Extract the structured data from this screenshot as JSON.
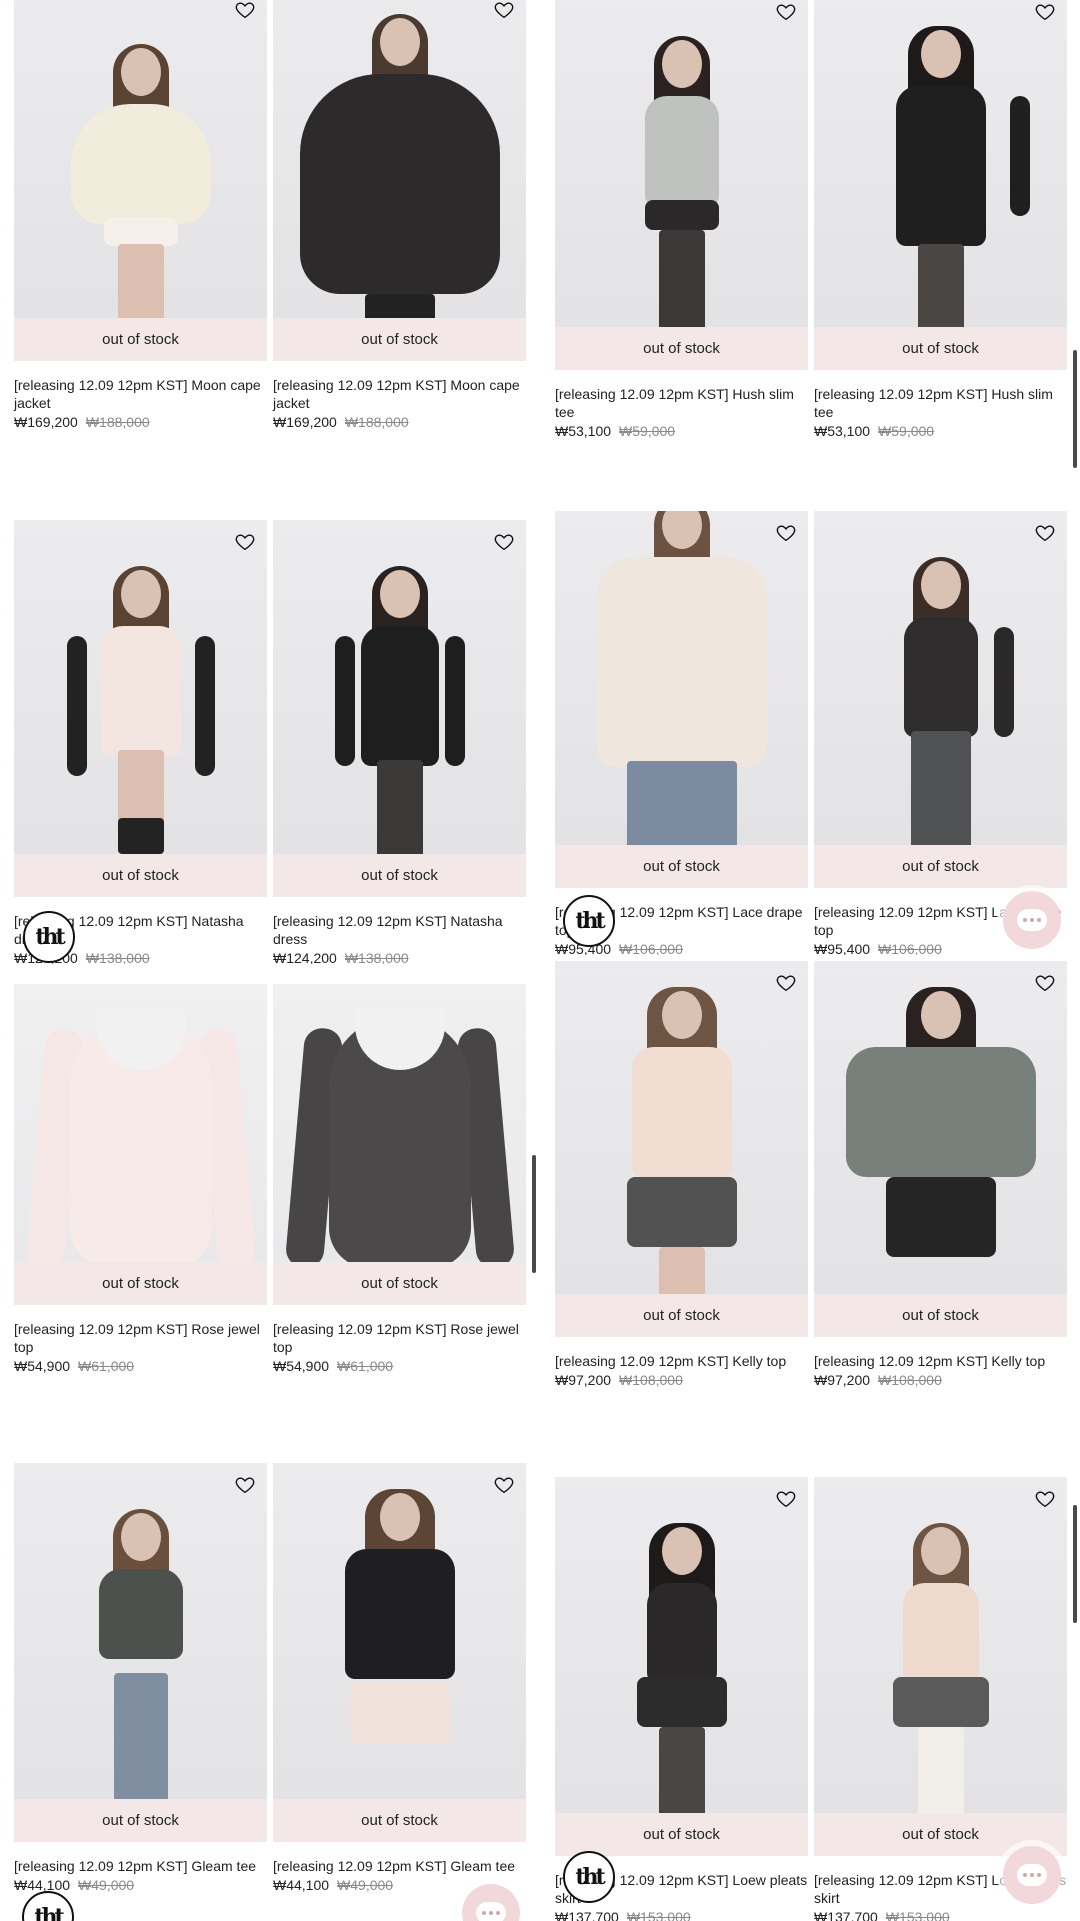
{
  "icons": {
    "wishlist": "heart-outline-icon",
    "brand_badge": "tht-logo-badge",
    "chat": "chat-bubble-icon"
  },
  "colors": {
    "oos_bg": "#f4e7e8",
    "strike_price": "#8a8a8a",
    "chat_bg": "#f2d8da"
  },
  "brand_badge": "tht",
  "left": {
    "r1c1": {
      "status": "out of stock",
      "title": "[releasing 12.09 12pm KST] Moon cape jacket",
      "price": "₩169,200",
      "orig": "₩188,000"
    },
    "r1c2": {
      "status": "out of stock",
      "title": "[releasing 12.09 12pm KST] Moon cape jacket",
      "price": "₩169,200",
      "orig": "₩188,000"
    },
    "r2c1": {
      "status": "out of stock",
      "title": "[releasing 12.09 12pm KST] Natasha dress",
      "price": "₩124,200",
      "orig": "₩138,000"
    },
    "r2c2": {
      "status": "out of stock",
      "title": "[releasing 12.09 12pm KST] Natasha dress",
      "price": "₩124,200",
      "orig": "₩138,000"
    },
    "r3c1": {
      "status": "out of stock",
      "title": "[releasing 12.09 12pm KST] Rose jewel top",
      "price": "₩54,900",
      "orig": "₩61,000"
    },
    "r3c2": {
      "status": "out of stock",
      "title": "[releasing 12.09 12pm KST] Rose jewel top",
      "price": "₩54,900",
      "orig": "₩61,000"
    },
    "r4c1": {
      "status": "out of stock",
      "title": "[releasing 12.09 12pm KST] Gleam tee",
      "price": "₩44,100",
      "orig": "₩49,000"
    },
    "r4c2": {
      "status": "out of stock",
      "title": "[releasing 12.09 12pm KST] Gleam tee",
      "price": "₩44,100",
      "orig": "₩49,000"
    }
  },
  "right": {
    "r1c1": {
      "status": "out of stock",
      "title": "[releasing 12.09 12pm KST] Hush slim tee",
      "price": "₩53,100",
      "orig": "₩59,000"
    },
    "r1c2": {
      "status": "out of stock",
      "title": "[releasing 12.09 12pm KST] Hush slim tee",
      "price": "₩53,100",
      "orig": "₩59,000"
    },
    "r2c1": {
      "status": "out of stock",
      "title": "[releasing 12.09 12pm KST] Lace drape top",
      "price": "₩95,400",
      "orig": "₩106,000"
    },
    "r2c2": {
      "status": "out of stock",
      "title": "[releasing 12.09 12pm KST] Lace drape top",
      "price": "₩95,400",
      "orig": "₩106,000"
    },
    "r3c1": {
      "status": "out of stock",
      "title": "[releasing 12.09 12pm KST] Kelly top",
      "price": "₩97,200",
      "orig": "₩108,000"
    },
    "r3c2": {
      "status": "out of stock",
      "title": "[releasing 12.09 12pm KST] Kelly top",
      "price": "₩97,200",
      "orig": "₩108,000"
    },
    "r4c1": {
      "status": "out of stock",
      "title": "[releasing 12.09 12pm KST] Loew pleats skirt",
      "price": "₩137,700",
      "orig": "₩153,000"
    },
    "r4c2": {
      "status": "out of stock",
      "title": "[releasing 12.09 12pm KST] Loew pleats skirt",
      "price": "₩137,700",
      "orig": "₩153,000"
    }
  }
}
